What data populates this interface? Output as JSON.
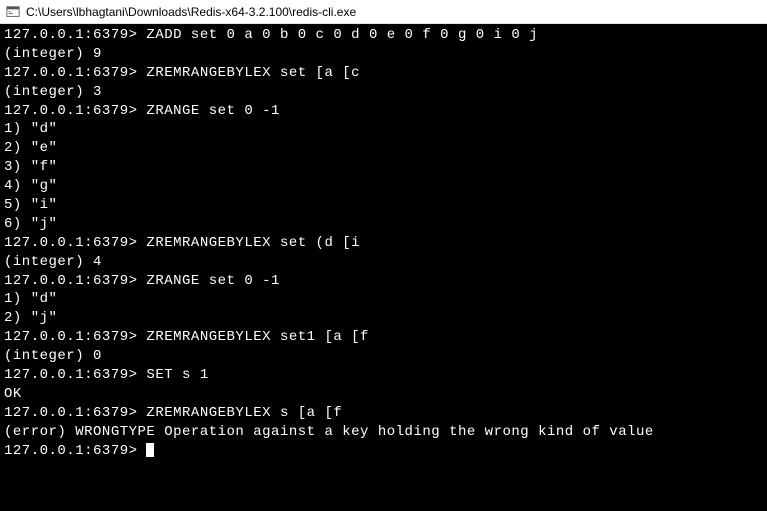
{
  "titlebar": {
    "path": "C:\\Users\\lbhagtani\\Downloads\\Redis-x64-3.2.100\\redis-cli.exe"
  },
  "terminal": {
    "prompt": "127.0.0.1:6379>",
    "lines": [
      "127.0.0.1:6379> ZADD set 0 a 0 b 0 c 0 d 0 e 0 f 0 g 0 i 0 j",
      "(integer) 9",
      "127.0.0.1:6379> ZREMRANGEBYLEX set [a [c",
      "(integer) 3",
      "127.0.0.1:6379> ZRANGE set 0 -1",
      "1) \"d\"",
      "2) \"e\"",
      "3) \"f\"",
      "4) \"g\"",
      "5) \"i\"",
      "6) \"j\"",
      "127.0.0.1:6379> ZREMRANGEBYLEX set (d [i",
      "(integer) 4",
      "127.0.0.1:6379> ZRANGE set 0 -1",
      "1) \"d\"",
      "2) \"j\"",
      "127.0.0.1:6379> ZREMRANGEBYLEX set1 [a [f",
      "(integer) 0",
      "127.0.0.1:6379> SET s 1",
      "OK",
      "127.0.0.1:6379> ZREMRANGEBYLEX s [a [f",
      "(error) WRONGTYPE Operation against a key holding the wrong kind of value"
    ],
    "current_prompt": "127.0.0.1:6379> "
  }
}
